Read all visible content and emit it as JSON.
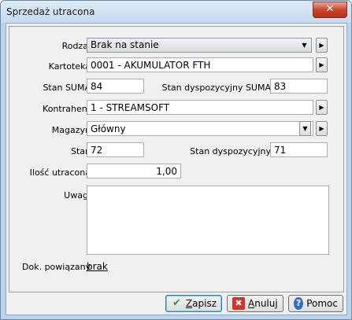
{
  "window": {
    "title": "Sprzedaż utracona",
    "close_label": "✕"
  },
  "form": {
    "rodzaj": {
      "label": "Rodzaj",
      "value": "Brak na stanie"
    },
    "kartoteka": {
      "label": "Kartoteka",
      "value": "0001 - AKUMULATOR FTH"
    },
    "stan_suma": {
      "label": "Stan SUMA",
      "value": "84"
    },
    "stan_dysp_suma": {
      "label": "Stan dyspozycyjny SUMA",
      "value": "83"
    },
    "kontrahent": {
      "label": "Kontrahent",
      "value": "1 - STREAMSOFT"
    },
    "magazyn": {
      "label": "Magazyn",
      "value": "Główny"
    },
    "stan": {
      "label": "Stan",
      "value": "72"
    },
    "stan_dysp": {
      "label": "Stan dyspozycyjny",
      "value": "71"
    },
    "ilosc": {
      "label": "Ilość utracona",
      "value": "1,00"
    },
    "uwagi": {
      "label": "Uwagi",
      "value": ""
    },
    "dok": {
      "label": "Dok. powiązany",
      "link": "brak"
    }
  },
  "buttons": {
    "save": {
      "underline": "Z",
      "rest": "apisz"
    },
    "cancel": {
      "underline": "A",
      "rest": "nuluj"
    },
    "help": {
      "label": "Pomoc"
    }
  }
}
